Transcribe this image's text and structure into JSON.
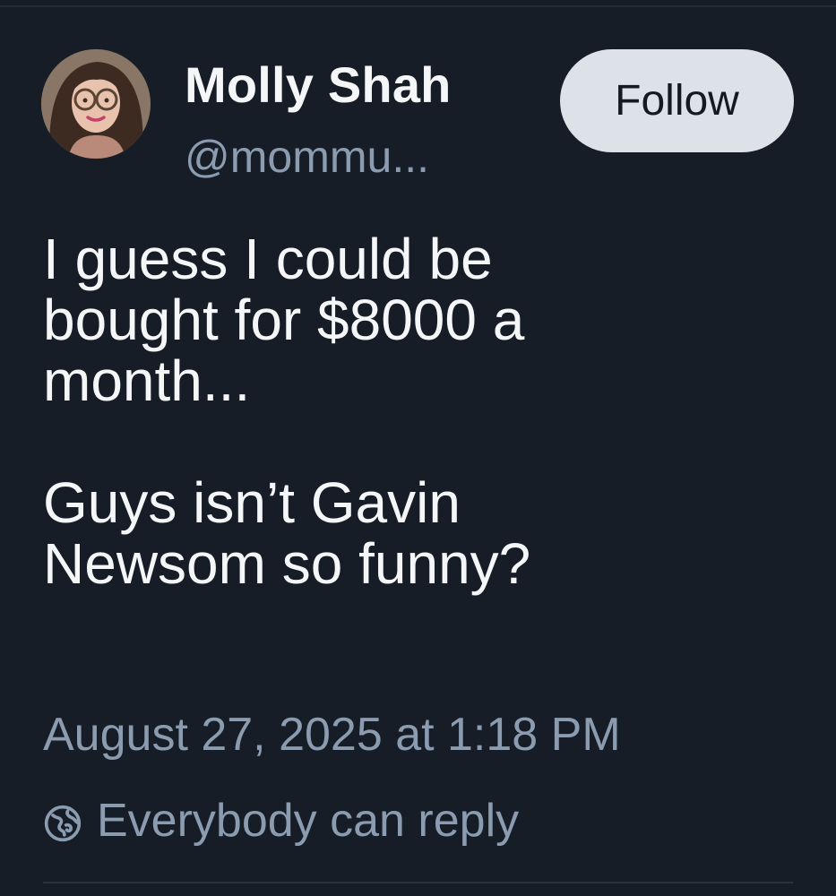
{
  "post": {
    "author": {
      "display_name": "Molly Shah",
      "handle": "@mommu..."
    },
    "follow_label": "Follow",
    "body_paragraphs": [
      "I guess I could be\nbought for $8000 a\nmonth...",
      "Guys isn’t Gavin\nNewsom so funny?"
    ],
    "timestamp": "August 27, 2025 at 1:18 PM",
    "reply_setting": {
      "icon": "globe-icon",
      "label": "Everybody can reply"
    }
  },
  "colors": {
    "background": "#171d26",
    "primary_text": "#f4f6f8",
    "secondary_text": "#8b9bb0",
    "follow_button_bg": "#dde2e8",
    "follow_button_text": "#141a22"
  }
}
